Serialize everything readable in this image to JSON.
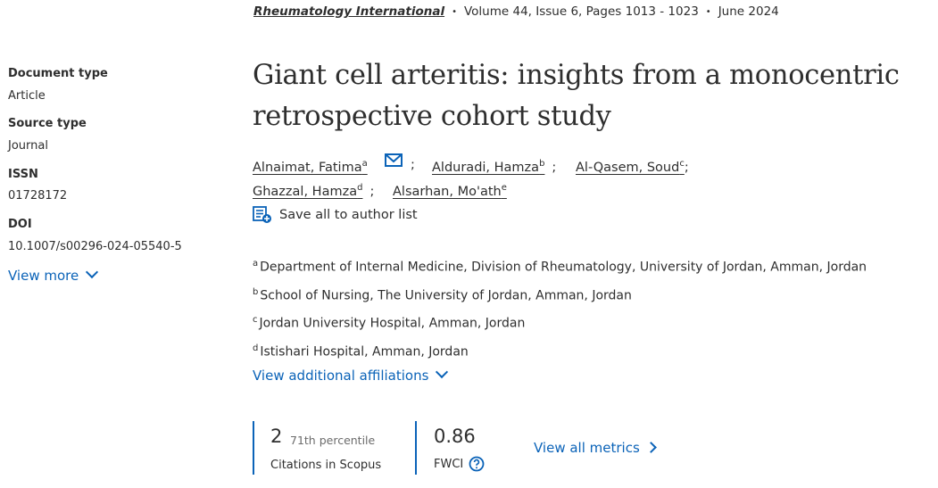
{
  "citation": {
    "journal": "Rheumatology International",
    "volume_pages": "Volume 44, Issue 6, Pages 1013 - 1023",
    "date": "June 2024",
    "separator": "•"
  },
  "sidebar": {
    "doc_type_label": "Document type",
    "doc_type_value": "Article",
    "source_type_label": "Source type",
    "source_type_value": "Journal",
    "issn_label": "ISSN",
    "issn_value": "01728172",
    "doi_label": "DOI",
    "doi_value": "10.1007/s00296-024-05540-5",
    "view_more": "View more"
  },
  "article": {
    "title_line1": "Giant cell arteritis: insights from a monocentric",
    "title_line2": "retrospective cohort study"
  },
  "authors": [
    {
      "name": "Alnaimat, Fatima",
      "sup": "a"
    },
    {
      "name": "Alduradi, Hamza",
      "sup": "b"
    },
    {
      "name": "Al-Qasem, Soud",
      "sup": "c"
    },
    {
      "name": "Ghazzal, Hamza",
      "sup": "d"
    },
    {
      "name": "Alsarhan, Mo'ath",
      "sup": "e"
    }
  ],
  "separators": {
    "semicolon": ";"
  },
  "save_all": "Save all to author list",
  "affiliations": [
    {
      "sup": "a",
      "text": "Department of Internal Medicine, Division of Rheumatology, University of Jordan, Amman, Jordan"
    },
    {
      "sup": "b",
      "text": "School of Nursing, The University of Jordan, Amman, Jordan"
    },
    {
      "sup": "c",
      "text": "Jordan University Hospital, Amman, Jordan"
    },
    {
      "sup": "d",
      "text": "Istishari Hospital, Amman, Jordan"
    }
  ],
  "view_additional_affiliations": "View additional affiliations",
  "metrics": {
    "citations_count": "2",
    "percentile": "71th percentile",
    "citations_label": "Citations in Scopus",
    "fwci_value": "0.86",
    "fwci_label": "FWCI",
    "view_all": "View all metrics"
  },
  "colors": {
    "link": "#0b63b8",
    "text": "#2e2e2e",
    "muted": "#6b6b6b"
  },
  "icons": {
    "email": "envelope-icon",
    "save": "author-list-add-icon",
    "help": "question-circle-icon"
  }
}
